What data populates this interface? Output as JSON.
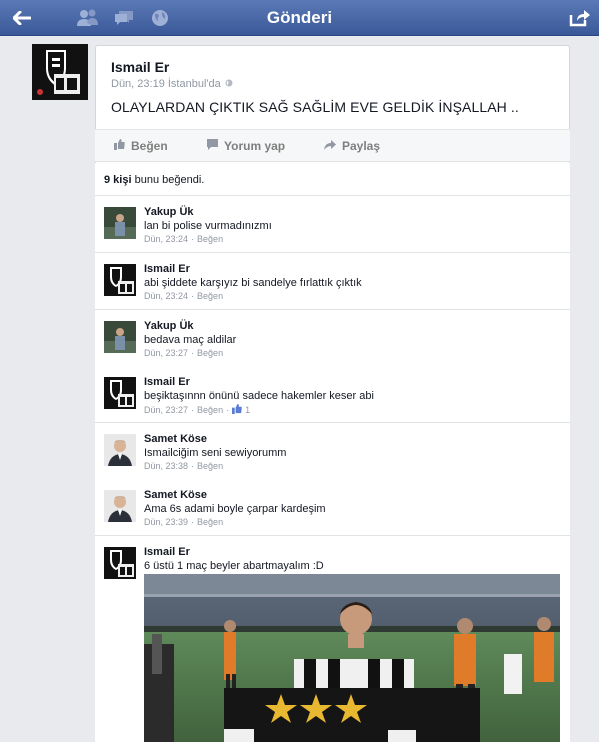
{
  "topbar": {
    "title": "Gönderi",
    "icons": [
      "back-arrow-icon",
      "friends-icon",
      "messages-icon",
      "globe-icon",
      "share-icon"
    ]
  },
  "post": {
    "author": "Ismail Er",
    "meta": "Dün, 23:19 İstanbul'da",
    "text": "OLAYLARDAN ÇIKTIK SAĞ SAĞLİM EVE GELDİK İNŞALLAH .."
  },
  "actions": {
    "like": "Beğen",
    "comment": "Yorum yap",
    "share": "Paylaş"
  },
  "likes": {
    "count": "9 kişi",
    "suffix": "bunu beğendi."
  },
  "comments": [
    {
      "author": "Yakup Ük",
      "text": "lan bi polise vurmadınızmı",
      "time": "Dün, 23:24",
      "like": "Beğen",
      "avatar": "yakup"
    },
    {
      "author": "Ismail Er",
      "text": "abi şiddete karşıyız bi sandelye fırlattık çıktık",
      "time": "Dün, 23:24",
      "like": "Beğen",
      "avatar": "ismail"
    },
    {
      "author": "Yakup Ük",
      "text": "bedava maç aldilar",
      "time": "Dün, 23:27",
      "like": "Beğen",
      "avatar": "yakup"
    },
    {
      "author": "Ismail Er",
      "text": "beşiktaşınnn önünü sadece hakemler keser abi",
      "time": "Dün, 23:27",
      "like": "Beğen",
      "like_count": "1",
      "avatar": "ismail"
    },
    {
      "author": "Samet Köse",
      "text": "Ismailciğim seni sewiyorumm",
      "time": "Dün, 23:38",
      "like": "Beğen",
      "avatar": "samet"
    },
    {
      "author": "Samet Köse",
      "text": "Ama 6s adami boyle çarpar kardeşim",
      "time": "Dün, 23:39",
      "like": "Beğen",
      "avatar": "samet"
    },
    {
      "author": "Ismail Er",
      "text": "6 üstü 1 maç beyler abartmayalım :D",
      "avatar": "ismail"
    }
  ],
  "colors": {
    "topbar": "#3b5998",
    "background": "#e9eaed",
    "meta_text": "#9197a3"
  }
}
